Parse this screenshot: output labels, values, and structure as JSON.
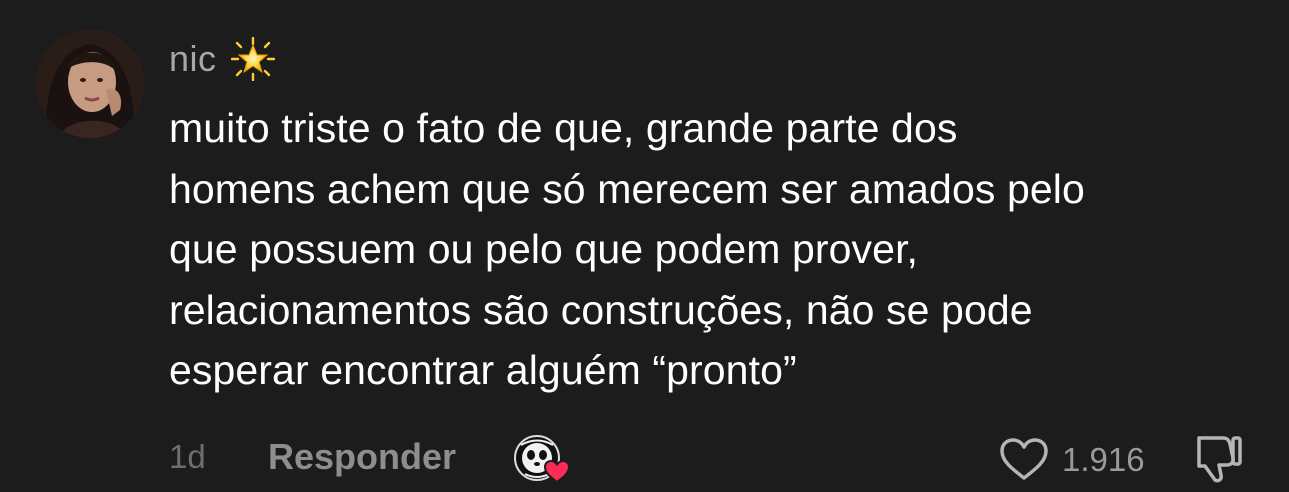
{
  "comment": {
    "username": "nic",
    "username_badge_icon": "glowing-star-icon",
    "avatar_icon": "user-avatar",
    "text_lines": [
      "muito triste o fato de que, grande parte dos",
      "homens achem que só merecem ser amados pelo",
      "que possuem ou pelo que podem prover,",
      "relacionamentos são construções, não se pode",
      "esperar encontrar alguém “pronto”"
    ],
    "timestamp": "1d",
    "reply_label": "Responder",
    "creator_liked_icon": "creator-liked-avatar-heart-icon",
    "like_icon": "heart-outline-icon",
    "like_count": "1.916",
    "dislike_icon": "thumbs-down-icon"
  },
  "colors": {
    "background": "#1c1c1d",
    "username": "#a7a7a9",
    "body_text": "#ffffff",
    "muted": "#6e6e71",
    "reply": "#8e8e91",
    "heart_badge": "#fe2c55"
  }
}
